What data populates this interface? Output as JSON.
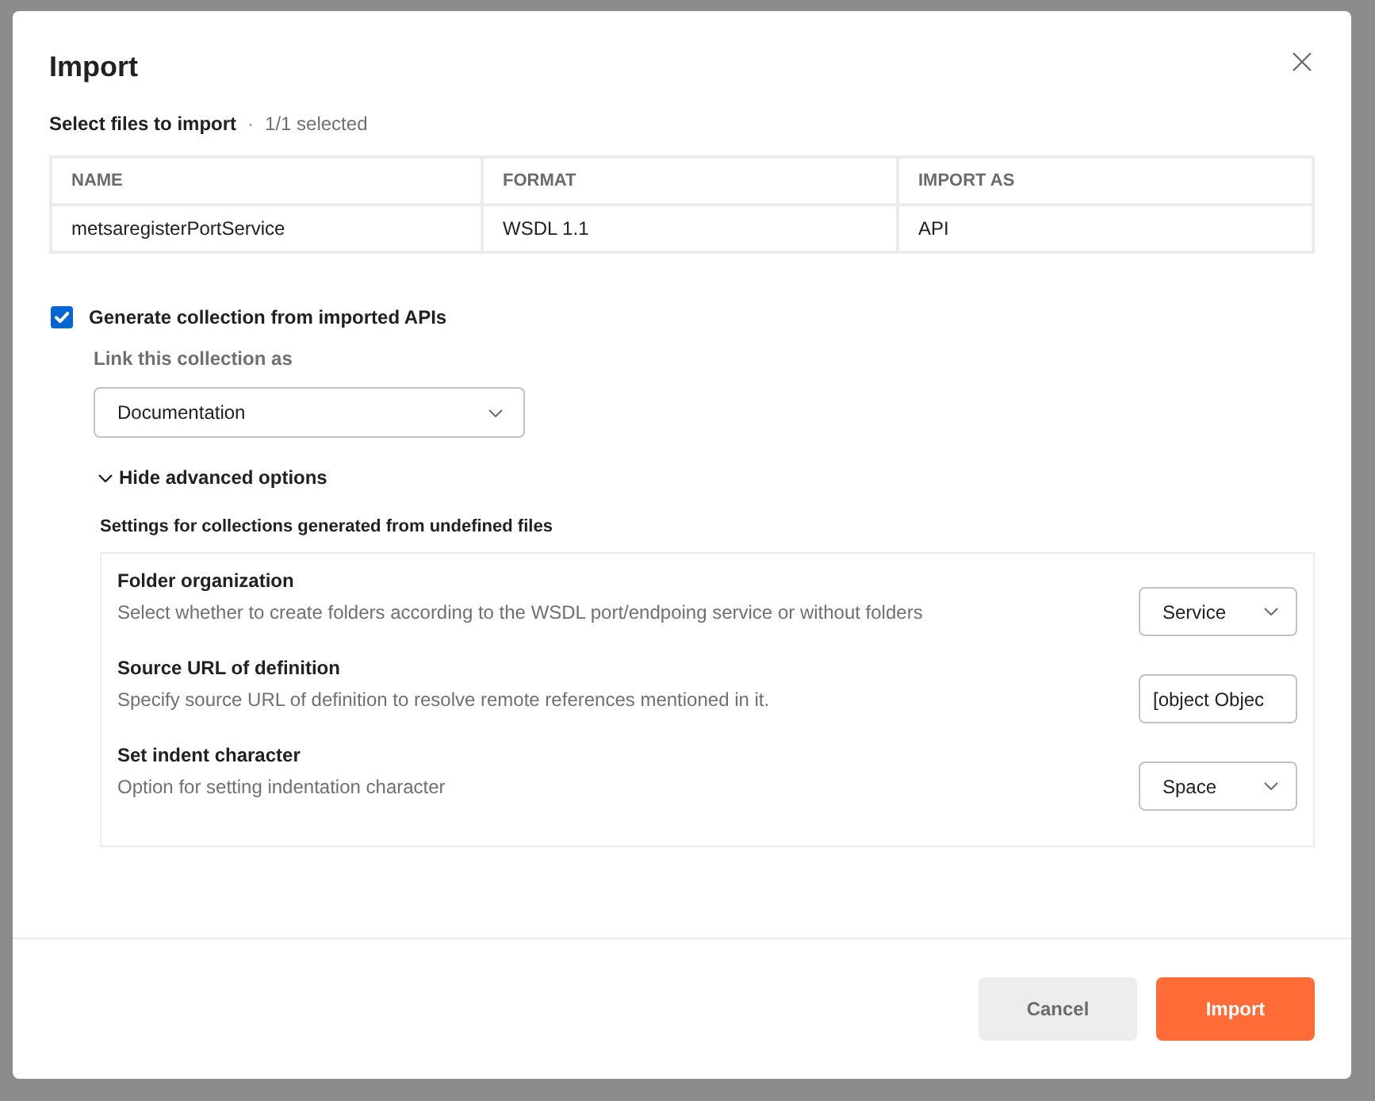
{
  "dialog": {
    "title": "Import"
  },
  "files": {
    "heading": "Select files to import",
    "separator": "·",
    "count": "1/1 selected"
  },
  "table": {
    "columns": [
      "NAME",
      "FORMAT",
      "IMPORT AS"
    ],
    "rows": [
      [
        "metsaregisterPortService",
        "WSDL 1.1",
        "API"
      ]
    ]
  },
  "generate": {
    "label": "Generate collection from imported APIs",
    "checked": true
  },
  "link_as": {
    "label": "Link this collection as",
    "value": "Documentation"
  },
  "advanced": {
    "label": "Hide advanced options",
    "expanded": true
  },
  "settings": {
    "heading": "Settings for collections generated from undefined files",
    "items": [
      {
        "title": "Folder organization",
        "description": "Select whether to create folders according to the WSDL port/endpoing service or without folders",
        "kind": "select",
        "value": "Service"
      },
      {
        "title": "Source URL of definition",
        "description": "Specify source URL of definition to resolve remote references mentioned in it.",
        "kind": "text",
        "value": "[object Objec"
      },
      {
        "title": "Set indent character",
        "description": "Option for setting indentation character",
        "kind": "select",
        "value": "Space"
      }
    ]
  },
  "buttons": [
    {
      "label": "Cancel",
      "kind": "cancel"
    },
    {
      "label": "Import",
      "kind": "primary"
    }
  ]
}
